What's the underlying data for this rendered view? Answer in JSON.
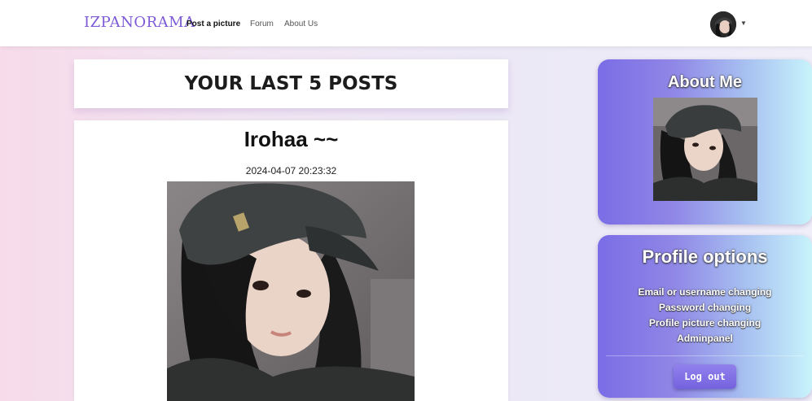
{
  "navbar": {
    "brand": "IZPANORAMA",
    "links": [
      {
        "label": "Post a picture"
      },
      {
        "label": "Forum"
      },
      {
        "label": "About Us"
      }
    ]
  },
  "posts": {
    "header": "YOUR LAST 5 POSTS",
    "items": [
      {
        "title": "Irohaa ~~",
        "date": "2024-04-07 20:23:32"
      }
    ]
  },
  "about": {
    "title": "About Me"
  },
  "profile_options": {
    "title": "Profile options",
    "links": [
      {
        "label": "Email or username changing"
      },
      {
        "label": "Password changing"
      },
      {
        "label": "Profile picture changing"
      },
      {
        "label": "Adminpanel"
      }
    ],
    "logout_label": "Log out"
  },
  "colors": {
    "brand": "#7d5ad6",
    "card_gradient_start": "#7a6de6",
    "card_gradient_end": "#c8f3fb"
  },
  "icons": {
    "avatar": "user-avatar-icon",
    "caret": "caret-down-icon"
  }
}
